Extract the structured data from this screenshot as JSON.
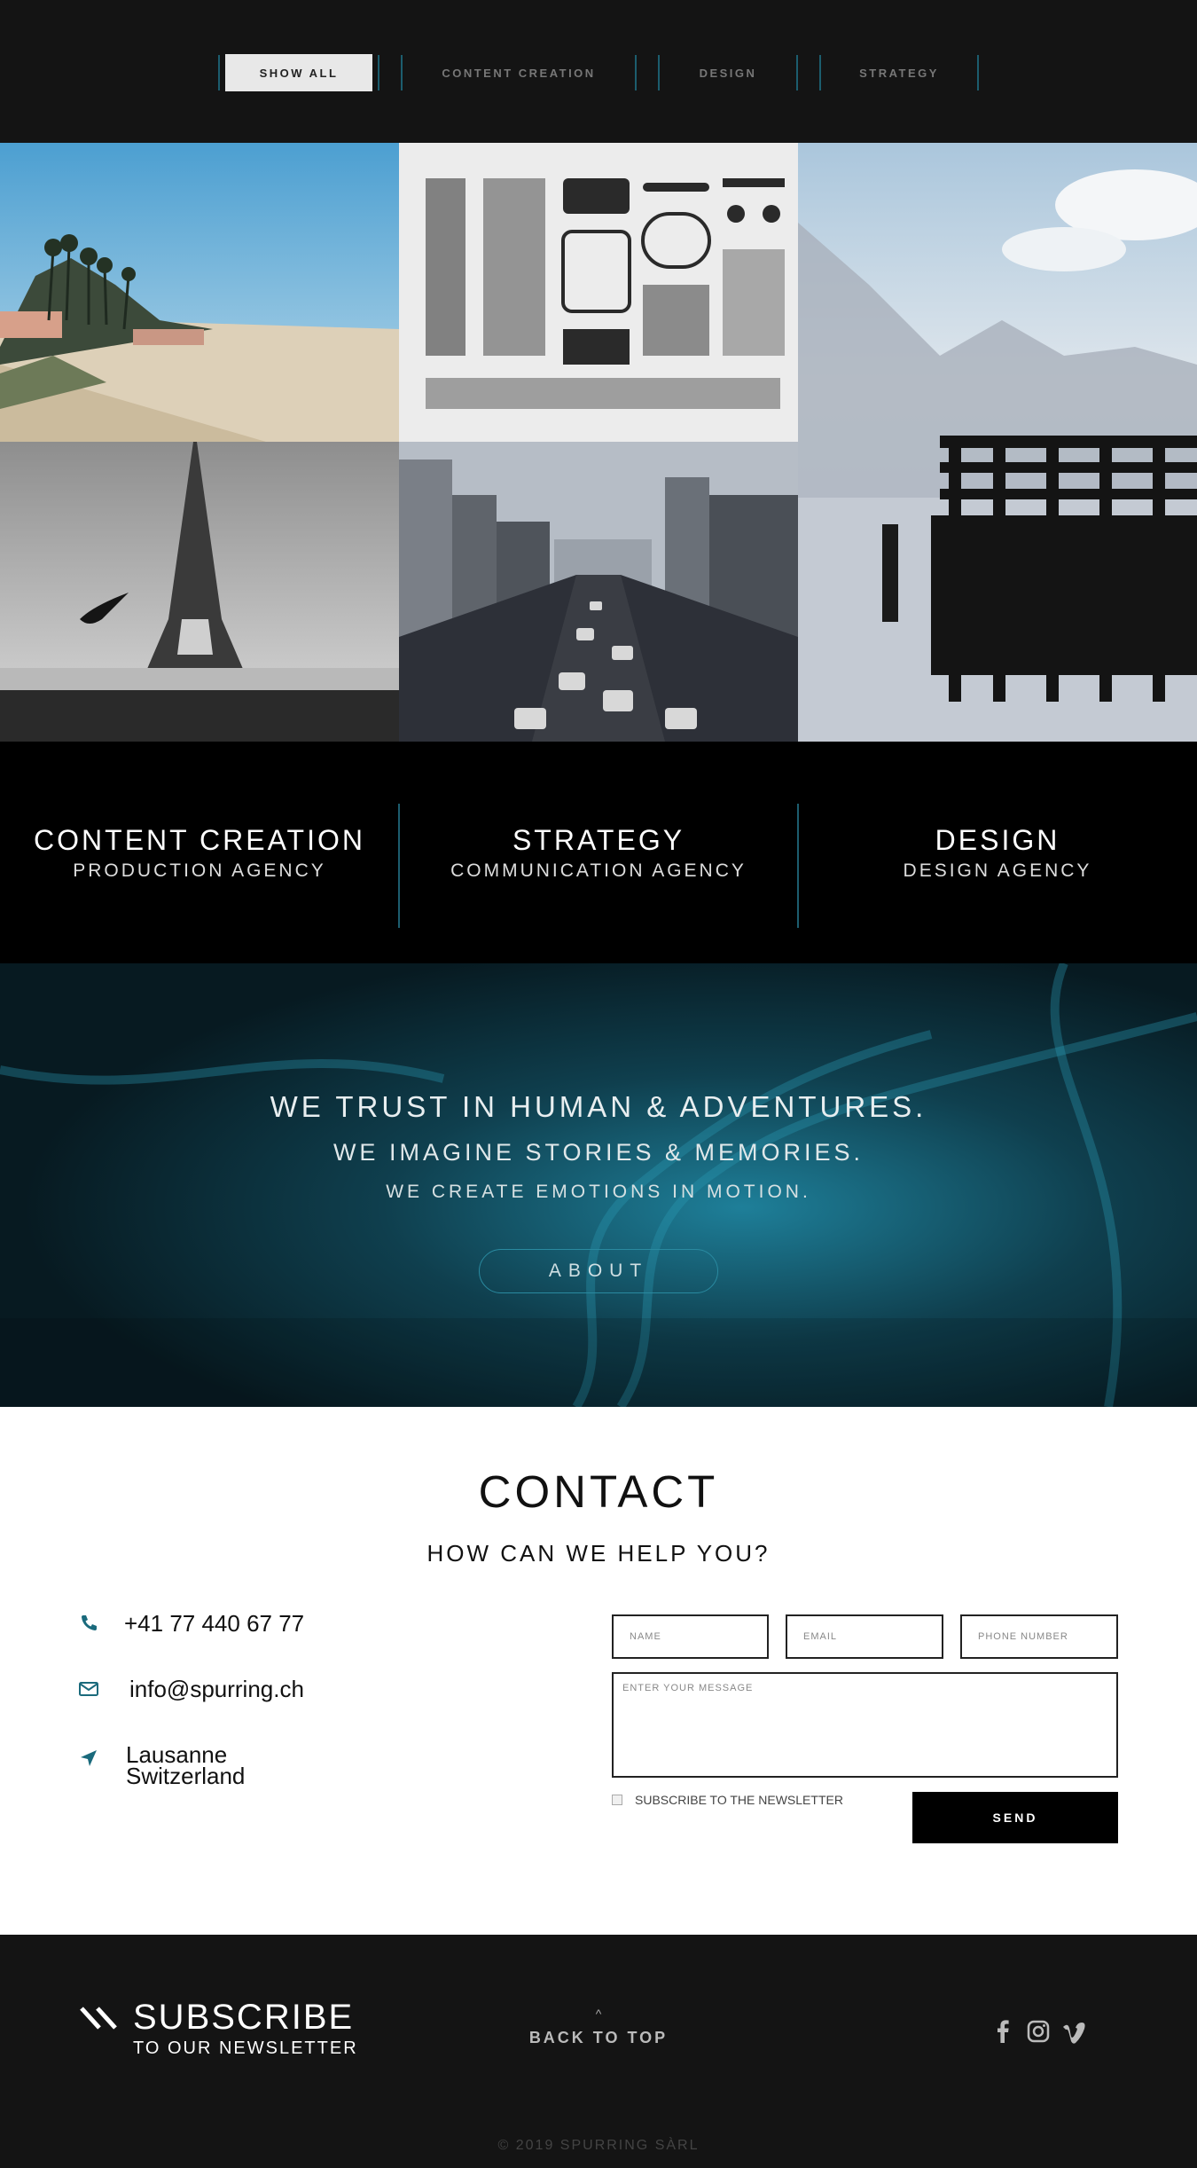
{
  "filters": {
    "items": [
      {
        "label": "SHOW ALL",
        "active": true
      },
      {
        "label": "CONTENT CREATION",
        "active": false
      },
      {
        "label": "DESIGN",
        "active": false
      },
      {
        "label": "STRATEGY",
        "active": false
      }
    ],
    "accent_color": "#1c5d6e"
  },
  "gallery": {
    "tiles": [
      "beach-photo",
      "typewriter-parts-photo",
      "mountain-lake-pier-photo",
      "eiffel-tower-photo",
      "city-traffic-photo"
    ]
  },
  "services": [
    {
      "title": "CONTENT CREATION",
      "subtitle": "PRODUCTION AGENCY"
    },
    {
      "title": "STRATEGY",
      "subtitle": "COMMUNICATION AGENCY"
    },
    {
      "title": "DESIGN",
      "subtitle": "DESIGN AGENCY"
    }
  ],
  "trust": {
    "line1": "WE TRUST IN HUMAN & ADVENTURES.",
    "line2": "WE IMAGINE STORIES & MEMORIES.",
    "line3": "WE CREATE EMOTIONS IN MOTION.",
    "about_label": "ABOUT"
  },
  "contact": {
    "title": "CONTACT",
    "subtitle": "HOW CAN WE HELP YOU?",
    "phone": "+41 77 440 67 77",
    "email": "info@spurring.ch",
    "city": "Lausanne",
    "country": "Switzerland",
    "form": {
      "name_placeholder": "NAME",
      "email_placeholder": "EMAIL",
      "phone_placeholder": "PHONE NUMBER",
      "message_placeholder": "ENTER YOUR MESSAGE",
      "newsletter_label": "SUBSCRIBE TO THE NEWSLETTER",
      "send_label": "SEND"
    },
    "icon_color": "#1a6a7c"
  },
  "footer": {
    "subscribe_title": "SUBSCRIBE",
    "subscribe_line": "TO OUR NEWSLETTER",
    "back_to_top_arrow": "^",
    "back_to_top": "BACK TO TOP",
    "socials": [
      "facebook-icon",
      "instagram-icon",
      "vimeo-icon"
    ],
    "copyright": "© 2019 SPURRING SÀRL"
  }
}
